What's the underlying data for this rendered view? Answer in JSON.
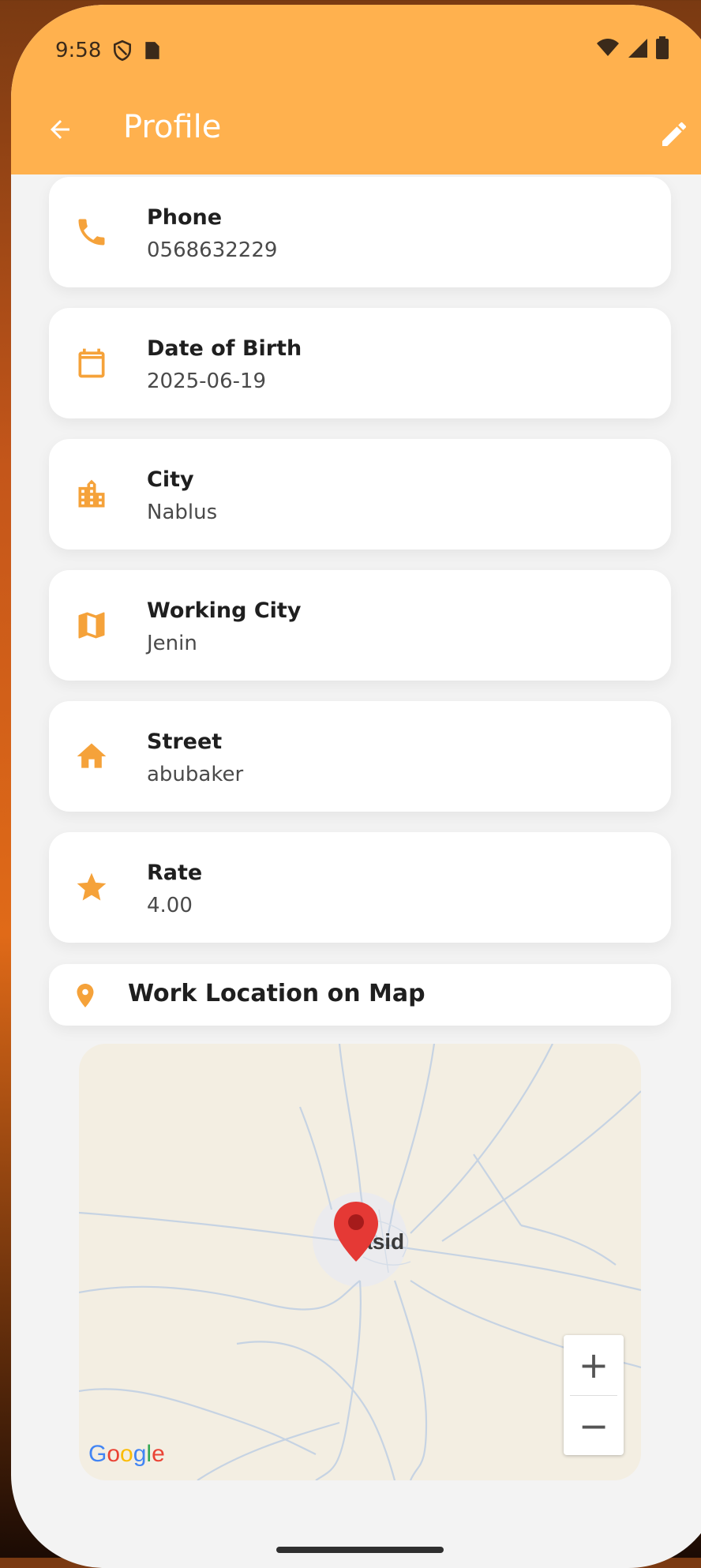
{
  "status_bar": {
    "time": "9:58"
  },
  "app_bar": {
    "title": "Profile"
  },
  "profile_fields": [
    {
      "label": "Phone",
      "value": "0568632229",
      "icon": "phone-icon"
    },
    {
      "label": "Date of Birth",
      "value": "2025-06-19",
      "icon": "calendar-icon"
    },
    {
      "label": "City",
      "value": "Nablus",
      "icon": "city-icon"
    },
    {
      "label": "Working City",
      "value": "Jenin",
      "icon": "map-icon"
    },
    {
      "label": "Street",
      "value": "abubaker",
      "icon": "home-icon"
    },
    {
      "label": "Rate",
      "value": "4.00",
      "icon": "star-icon"
    }
  ],
  "map_section": {
    "title": "Work Location on Map",
    "place_label": "Yasid",
    "zoom_in_label": "+",
    "zoom_out_label": "−",
    "attribution": "Google"
  },
  "colors": {
    "accent": "#ffb14e",
    "icon": "#f5a23a",
    "background": "#f3f3f3",
    "card": "#ffffff",
    "pin": "#e53935"
  }
}
